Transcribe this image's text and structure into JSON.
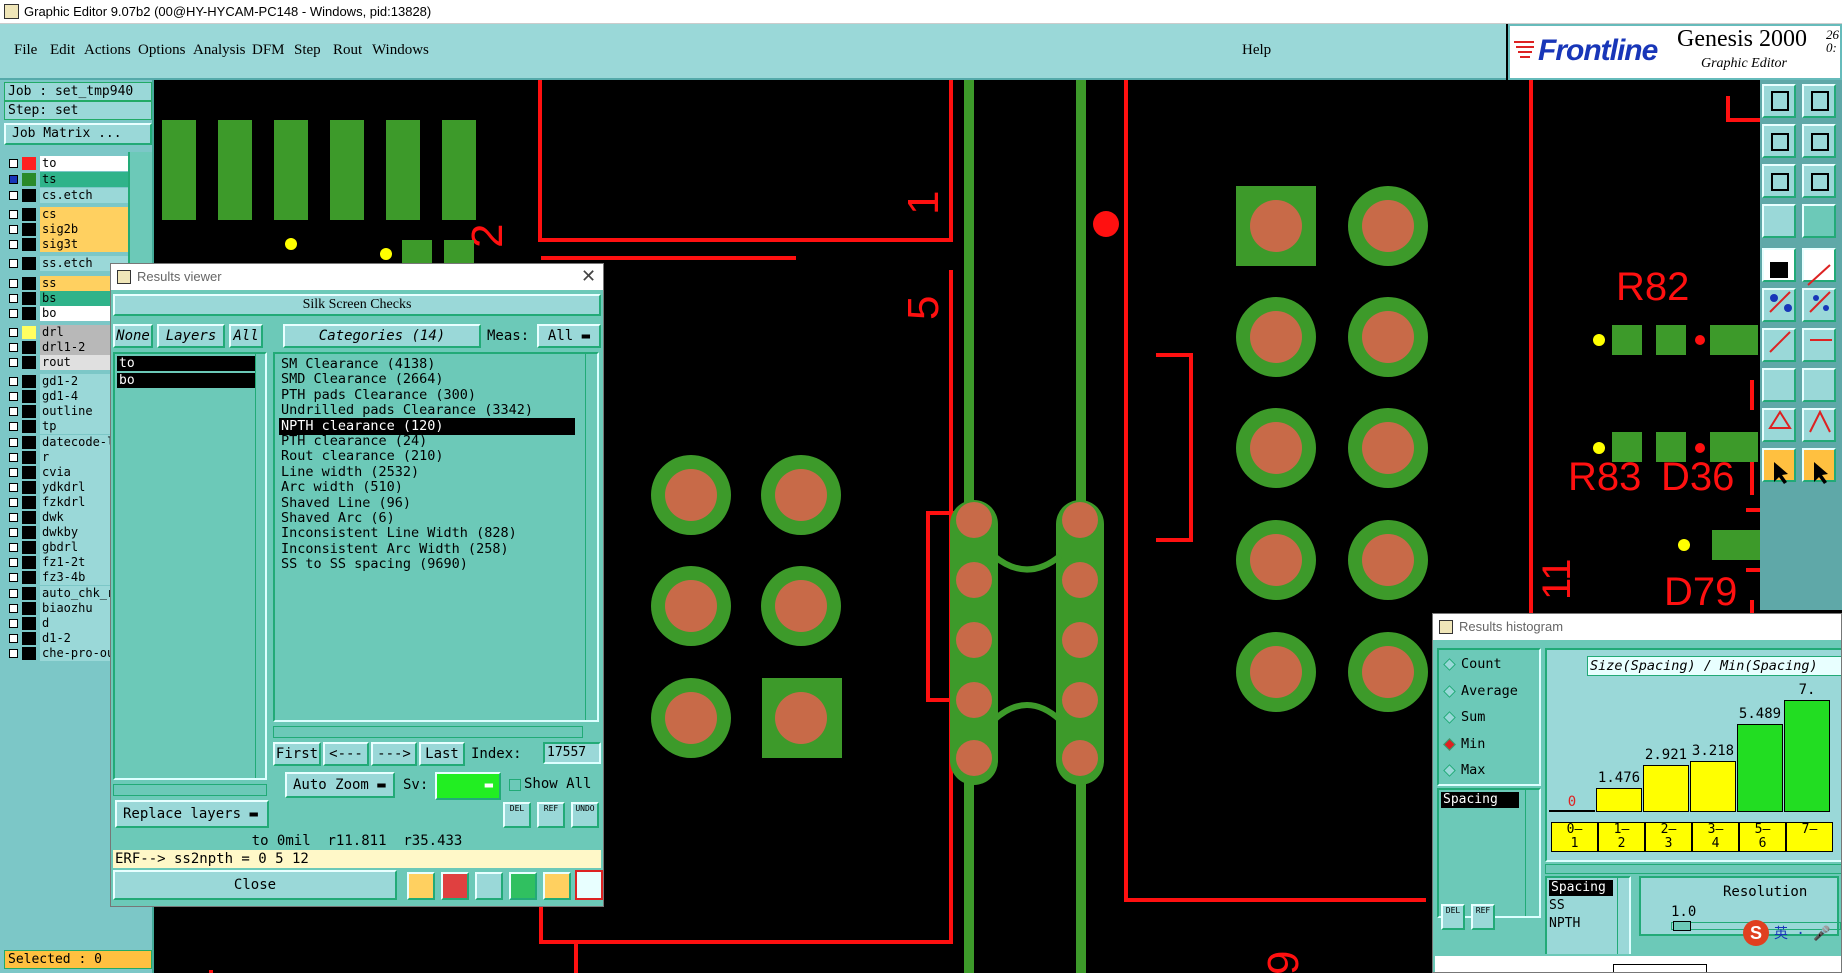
{
  "window": {
    "title": "Graphic Editor 9.07b2 (00@HY-HYCAM-PC148 - Windows, pid:13828)"
  },
  "menu": {
    "items": [
      "File",
      "Edit",
      "Actions",
      "Options",
      "Analysis",
      "DFM",
      "Step",
      "Rout",
      "Windows"
    ],
    "help": "Help"
  },
  "brand": {
    "logo": "Frontline",
    "product": "Genesis 2000",
    "version": "26\n0:",
    "subtitle": "Graphic Editor"
  },
  "job": {
    "job_label": "Job : set_tmp940",
    "step_label": "Step: set",
    "matrix_button": "Job Matrix ..."
  },
  "layers": [
    {
      "name": "to",
      "color": "#ff2020",
      "label_bg": "#ffffff"
    },
    {
      "name": "ts",
      "color": "#2a8a2a",
      "label_bg": "#2fb38a"
    },
    {
      "name": "cs.etch",
      "color": "#000000",
      "label_bg": "#9ad8d8"
    },
    {
      "name": "cs",
      "color": "#000000",
      "label_bg": "#ffd060"
    },
    {
      "name": "sig2b",
      "color": "#000000",
      "label_bg": "#ffd060"
    },
    {
      "name": "sig3t",
      "color": "#000000",
      "label_bg": "#ffd060"
    },
    {
      "name": "ss.etch",
      "color": "#000000",
      "label_bg": "#9ad8d8"
    },
    {
      "name": "ss",
      "color": "#000000",
      "label_bg": "#ffd060"
    },
    {
      "name": "bs",
      "color": "#000000",
      "label_bg": "#2fb38a"
    },
    {
      "name": "bo",
      "color": "#000000",
      "label_bg": "#ffffff"
    },
    {
      "name": "drl",
      "color": "#ffff60",
      "label_bg": "#b8b8b8"
    },
    {
      "name": "drl1-2",
      "color": "#000000",
      "label_bg": "#b8b8b8"
    },
    {
      "name": "rout",
      "color": "#000000",
      "label_bg": "#e0e0e0"
    },
    {
      "name": "gd1-2",
      "color": "#000000",
      "label_bg": "#9ad8d8"
    },
    {
      "name": "gd1-4",
      "color": "#000000",
      "label_bg": "#9ad8d8"
    },
    {
      "name": "outline",
      "color": "#000000",
      "label_bg": "#9ad8d8"
    },
    {
      "name": "tp",
      "color": "#000000",
      "label_bg": "#9ad8d8"
    },
    {
      "name": "datecode-l",
      "color": "#000000",
      "label_bg": "#9ad8d8"
    },
    {
      "name": "r",
      "color": "#000000",
      "label_bg": "#9ad8d8"
    },
    {
      "name": "cvia",
      "color": "#000000",
      "label_bg": "#9ad8d8"
    },
    {
      "name": "ydkdrl",
      "color": "#000000",
      "label_bg": "#9ad8d8"
    },
    {
      "name": "fzkdrl",
      "color": "#000000",
      "label_bg": "#9ad8d8"
    },
    {
      "name": "dwk",
      "color": "#000000",
      "label_bg": "#9ad8d8"
    },
    {
      "name": "dwkby",
      "color": "#000000",
      "label_bg": "#9ad8d8"
    },
    {
      "name": "gbdrl",
      "color": "#000000",
      "label_bg": "#9ad8d8"
    },
    {
      "name": "fz1-2t",
      "color": "#000000",
      "label_bg": "#9ad8d8"
    },
    {
      "name": "fz3-4b",
      "color": "#000000",
      "label_bg": "#9ad8d8"
    },
    {
      "name": "auto_chk_r",
      "color": "#000000",
      "label_bg": "#9ad8d8"
    },
    {
      "name": "biaozhu",
      "color": "#000000",
      "label_bg": "#9ad8d8"
    },
    {
      "name": "d",
      "color": "#000000",
      "label_bg": "#9ad8d8"
    },
    {
      "name": "d1-2",
      "color": "#000000",
      "label_bg": "#9ad8d8"
    },
    {
      "name": "che-pro-ou",
      "color": "#000000",
      "label_bg": "#9ad8d8"
    }
  ],
  "status": {
    "selected": "Selected : 0"
  },
  "canvas": {
    "labels": [
      "2",
      "1",
      "5",
      "R82",
      "R83",
      "D36",
      "11",
      "D79",
      "9"
    ]
  },
  "results_viewer": {
    "title": "Results viewer",
    "header": "Silk Screen Checks",
    "none_btn": "None",
    "layers_btn": "Layers",
    "all_btn": "All",
    "layer_list": [
      "to",
      "bo"
    ],
    "categories_btn": "Categories (14)",
    "meas_label": "Meas:",
    "meas_value": "All",
    "categories": [
      "SM Clearance (4138)",
      "SMD Clearance (2664)",
      "PTH pads Clearance (300)",
      "Undrilled pads Clearance (3342)",
      "NPTH clearance (120)",
      "PTH clearance (24)",
      "Rout clearance (210)",
      "Line width (2532)",
      "Arc width (510)",
      "Shaved Line (96)",
      "Shaved Arc (6)",
      "Inconsistent Line Width (828)",
      "Inconsistent Arc Width (258)",
      "SS to SS spacing (9690)"
    ],
    "selected_category": "NPTH clearance (120)",
    "first_btn": "First",
    "prev_btn": "<---",
    "next_btn": "--->",
    "last_btn": "Last",
    "index_label": "Index:",
    "index_value": "17557",
    "zoom_btn": "Auto Zoom",
    "sv_label": "Sv:",
    "show_all": "Show All",
    "del_btn": "DEL",
    "ref_btn": "REF",
    "undo_btn": "UNDO",
    "replace_btn": "Replace layers",
    "info_line": "to 0mil  r11.811  r35.433",
    "erf_line": "ERF--> ss2npth = 0 5 12",
    "close_btn": "Close"
  },
  "histogram": {
    "title": "Results histogram",
    "options": [
      "Count",
      "Average",
      "Sum",
      "Min",
      "Max"
    ],
    "selected_option": "Min",
    "measure_list": [
      "Spacing"
    ],
    "plot_title": "Size(Spacing) / Min(Spacing)",
    "del_btn": "DEL",
    "ref_btn": "REF",
    "resolution_label": "Resolution",
    "resolution_value": "1.0",
    "type_list": [
      "Spacing",
      "SS",
      "NPTH"
    ]
  },
  "chart_data": {
    "type": "bar",
    "title": "Size(Spacing) / Min(Spacing)",
    "categories": [
      "0-1",
      "1-2",
      "2-3",
      "3-4",
      "5-6",
      "7-"
    ],
    "values": [
      0,
      1.476,
      2.921,
      3.218,
      5.489,
      7.0
    ],
    "value_labels": [
      "0",
      "1.476",
      "2.921",
      "3.218",
      "5.489",
      "7."
    ],
    "colors": [
      "#ffff00",
      "#ffff00",
      "#ffff00",
      "#ffff00",
      "#22dd22",
      "#22dd22"
    ]
  }
}
